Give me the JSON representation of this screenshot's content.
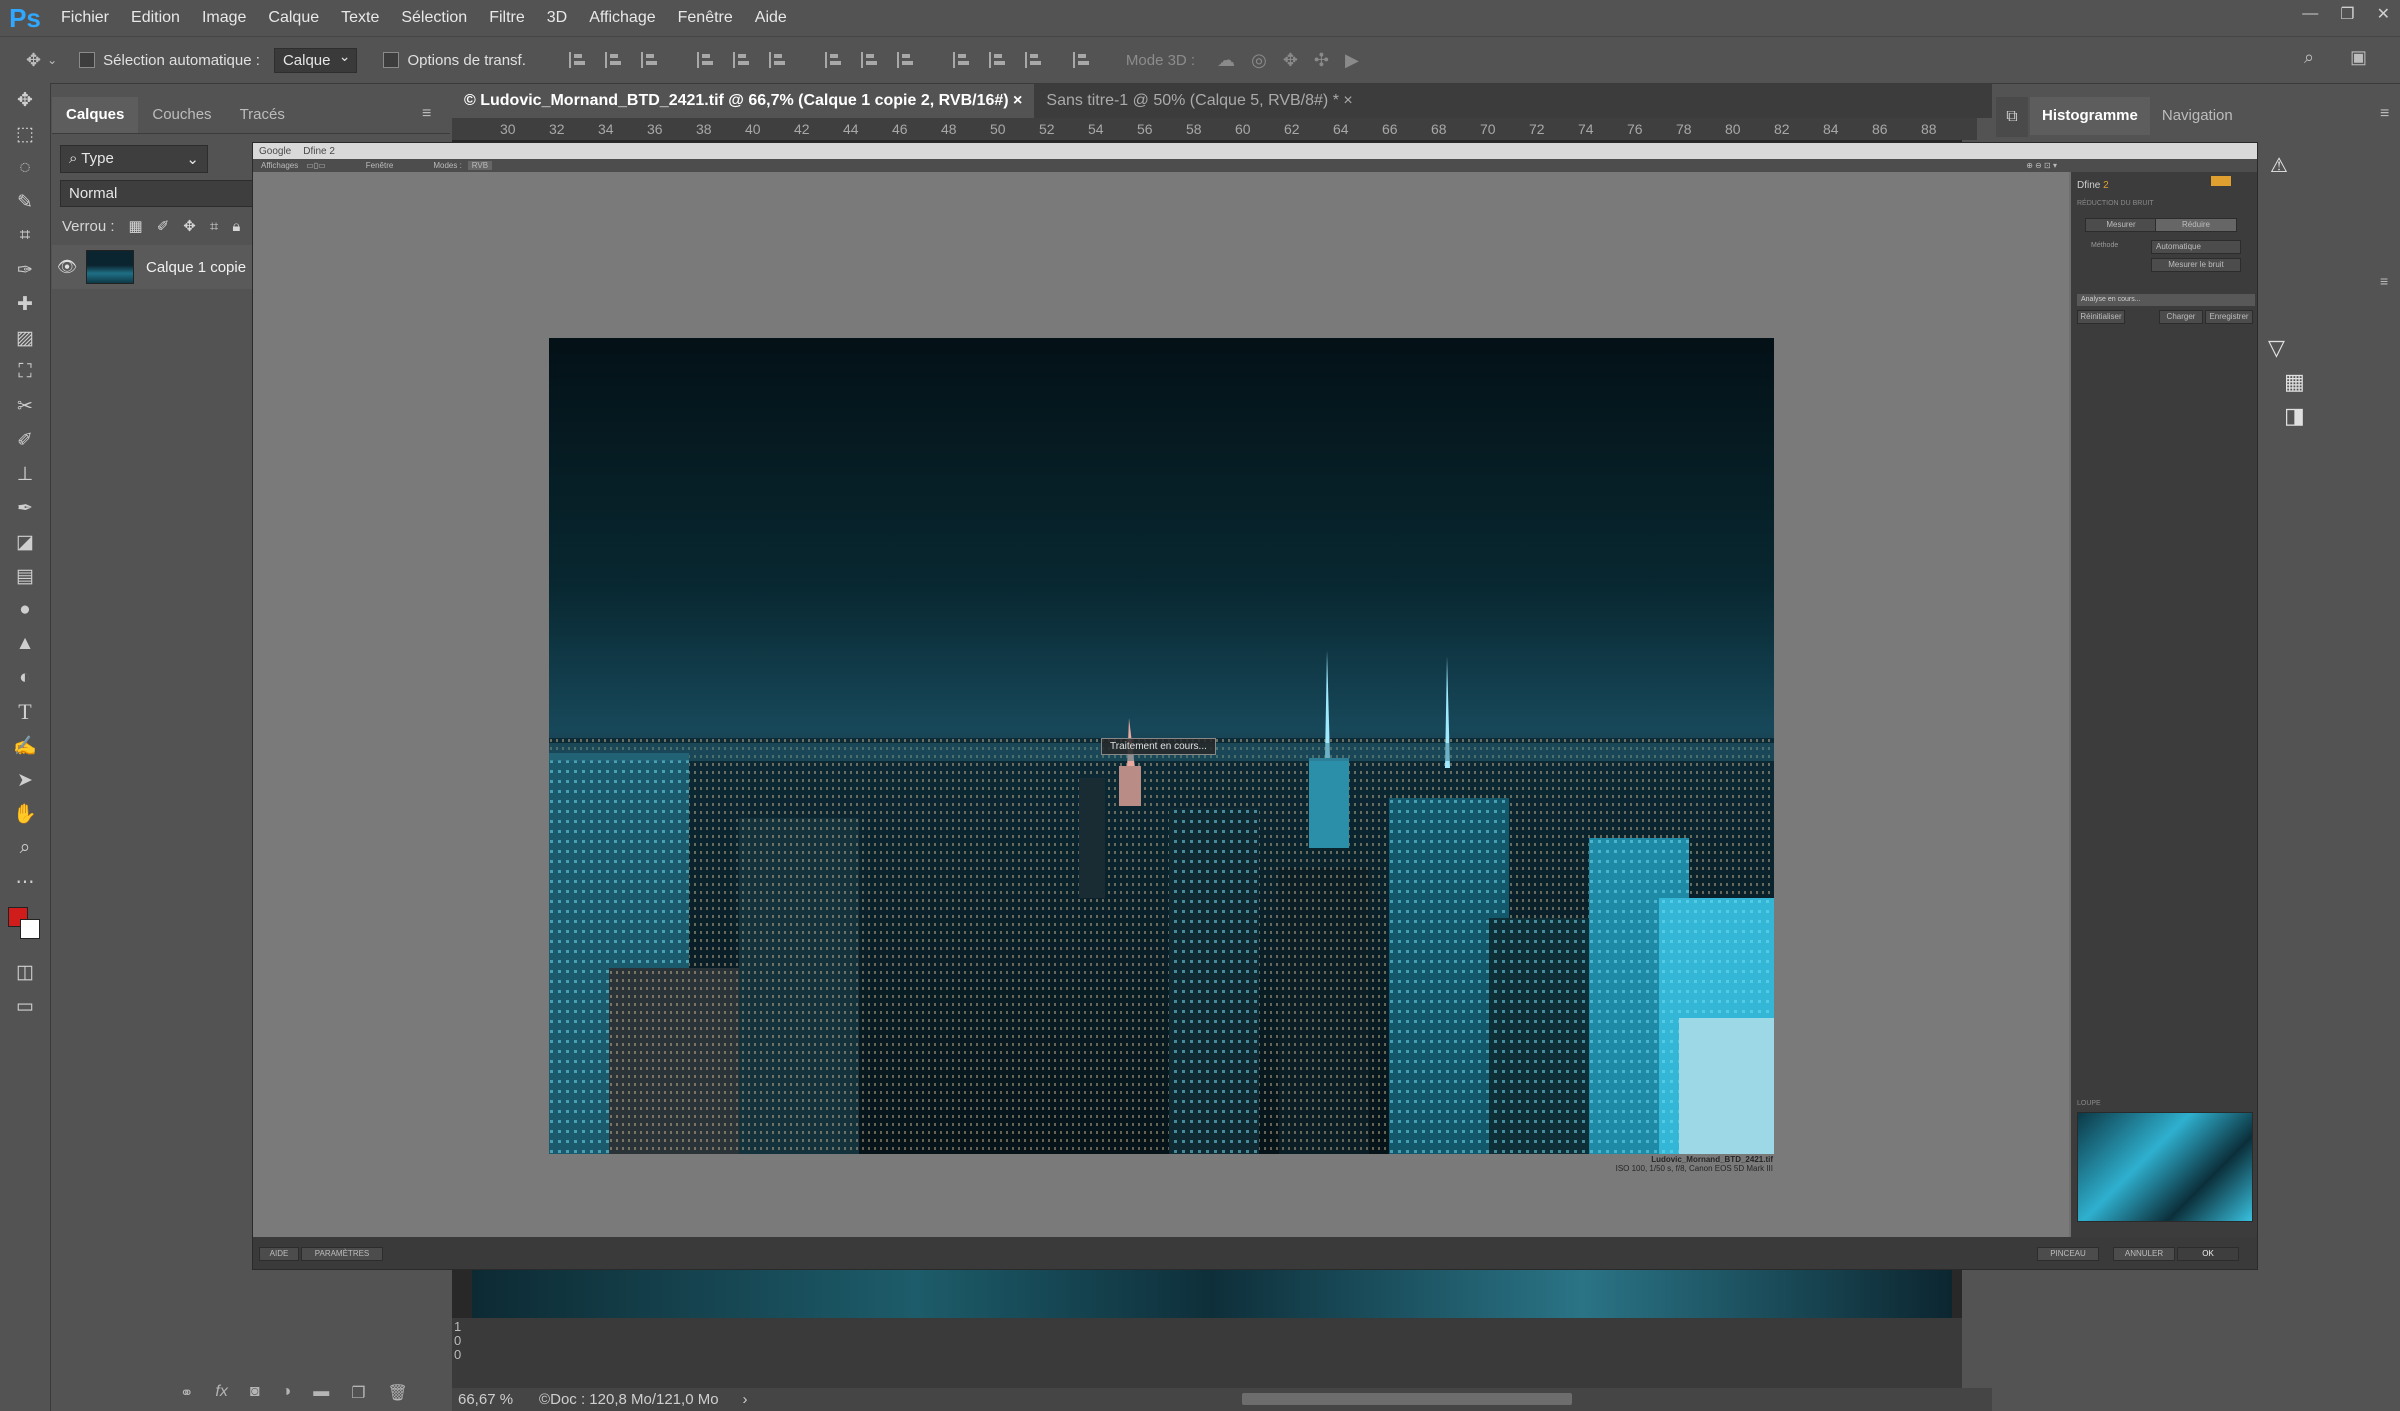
{
  "app": {
    "logo": "Ps"
  },
  "menu": [
    "Fichier",
    "Edition",
    "Image",
    "Calque",
    "Texte",
    "Sélection",
    "Filtre",
    "3D",
    "Affichage",
    "Fenêtre",
    "Aide"
  ],
  "options": {
    "auto_select_label": "Sélection automatique :",
    "auto_select_value": "Calque",
    "transform_label": "Options de transf.",
    "mode3d_label": "Mode 3D :"
  },
  "layers_panel": {
    "tabs": [
      "Calques",
      "Couches",
      "Tracés"
    ],
    "filter_value": "Type",
    "blend_mode": "Normal",
    "lock_label": "Verrou :",
    "layer_name": "Calque 1 copie",
    "footer_fx": "fx"
  },
  "documents": {
    "tabs": [
      "© Ludovic_Mornand_BTD_2421.tif @ 66,7% (Calque 1 copie 2, RVB/16#)",
      "Sans titre-1 @ 50% (Calque 5, RVB/8#) *"
    ],
    "close_glyph": "×",
    "ruler_ticks": [
      "30",
      "32",
      "34",
      "36",
      "38",
      "40",
      "42",
      "44",
      "46",
      "48",
      "50",
      "52",
      "54",
      "56",
      "58",
      "60",
      "62",
      "64",
      "66",
      "68",
      "70",
      "72",
      "74",
      "76",
      "78",
      "80",
      "82",
      "84",
      "86",
      "88"
    ],
    "vertical_ruler": [
      "1",
      "0",
      "0"
    ]
  },
  "status": {
    "zoom": "66,67 %",
    "doc": "Doc : 120,8 Mo/121,0 Mo"
  },
  "right_panel": {
    "tabs": [
      "Histogramme",
      "Navigation"
    ]
  },
  "dfine": {
    "title_brand": "Google",
    "title": "Dfine 2",
    "toolbar": [
      "Affichages",
      "Fenêtre",
      "Modes :",
      "RVB"
    ],
    "side_title": "Dfine",
    "side_title_version": "2",
    "side_section": "RÉDUCTION DU BRUIT",
    "side_btn_measure": "Mesurer",
    "side_btn_reduce": "Réduire",
    "side_method_label": "Méthode",
    "side_method_value": "Automatique",
    "side_btn_measure_noise": "Mesurer le bruit",
    "side_analysis": "Analyse en cours...",
    "side_btn_restore": "Réinitialiser",
    "side_btn_load": "Charger",
    "side_btn_save": "Enregistrer",
    "loupe_label": "LOUPE",
    "processing": "Traitement en cours...",
    "caption_file": "Ludovic_Mornand_BTD_2421.tif",
    "caption_meta": "ISO 100, 1/50 s, f/8, Canon EOS 5D Mark III",
    "bottom_left": [
      "AIDE",
      "PARAMÈTRES"
    ],
    "bottom_right": [
      "PINCEAU",
      "ANNULER",
      "OK"
    ]
  },
  "colors": {
    "foreground": "#d11c1c",
    "background": "#ffffff",
    "ps_blue": "#31a8ff",
    "dfine_accent": "#e0a030"
  }
}
